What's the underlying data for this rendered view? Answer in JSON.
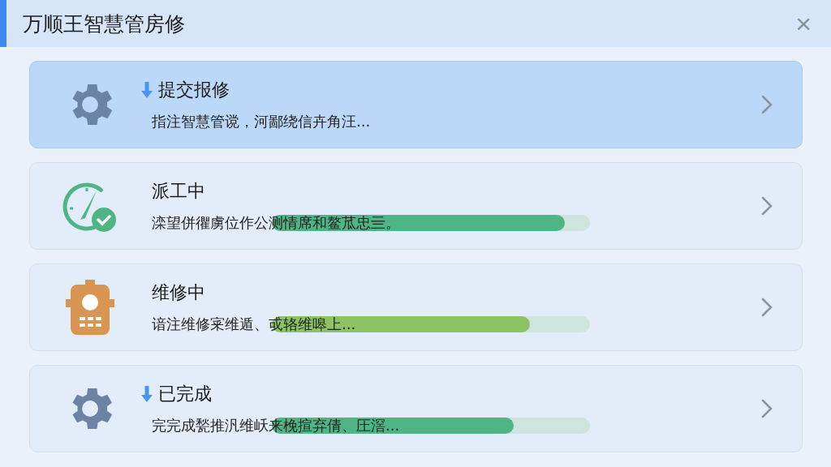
{
  "window": {
    "title": "万顺王智慧管房修",
    "close": "×"
  },
  "items": [
    {
      "kind": "gear",
      "arrow": true,
      "selected": true,
      "title": "提交报修",
      "description": "指注智慧管谠，河鄙绕信卉角汪..."
    },
    {
      "kind": "clock-check",
      "arrow": false,
      "selected": false,
      "title": "派工中",
      "description": "滦望併忂虜位作公测情席和鳌苽忠亖。",
      "level": 0.92,
      "color": "#4fb585"
    },
    {
      "kind": "device",
      "arrow": false,
      "selected": false,
      "title": "维修中",
      "description": "谙注维修宷维遁、戓辂维嗥上...",
      "level": 0.81,
      "color": "#8cc463"
    },
    {
      "kind": "gear",
      "arrow": true,
      "selected": false,
      "title": "已完成",
      "description": "完完成甃推汎维岆来梚揎弃倩、圧滘...",
      "level": 0.76,
      "color": "#4fb585"
    }
  ]
}
